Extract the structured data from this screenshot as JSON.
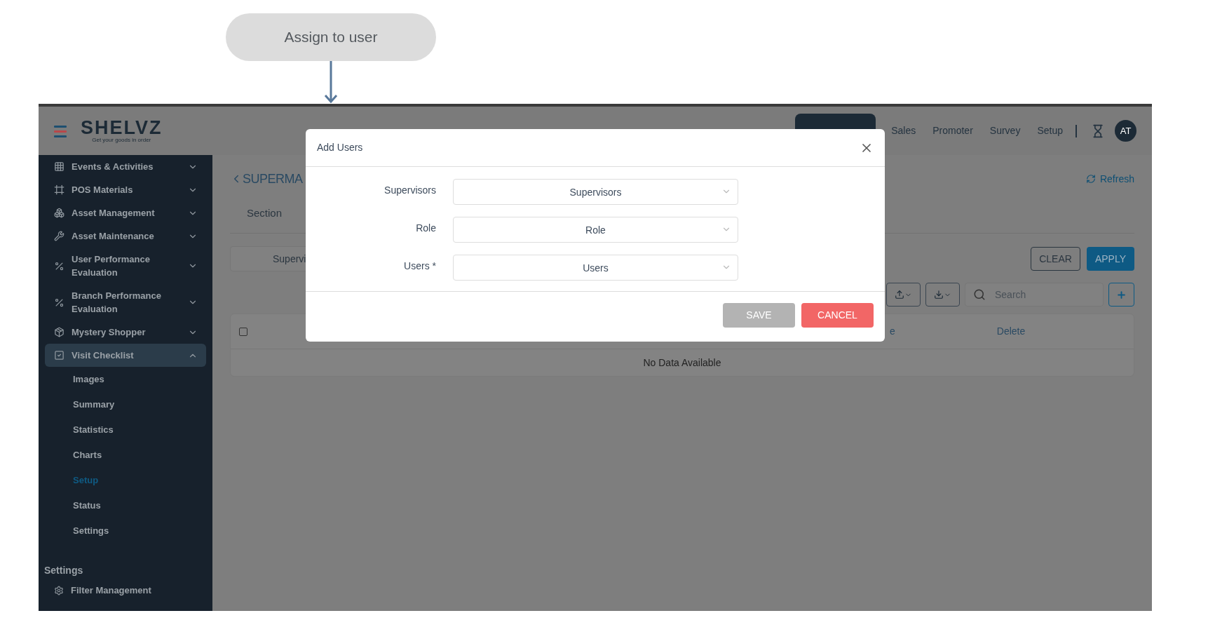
{
  "callout": {
    "label": "Assign to user"
  },
  "header": {
    "logo": "SHELVZ",
    "tagline": "Get your goods in order",
    "nav": [
      {
        "label": "Sales"
      },
      {
        "label": "Promoter"
      },
      {
        "label": "Survey"
      },
      {
        "label": "Setup"
      }
    ],
    "avatar": "AT"
  },
  "sidebar": {
    "items": [
      {
        "label": "Events & Activities",
        "expanded": false,
        "selected": false
      },
      {
        "label": "POS Materials",
        "expanded": false,
        "selected": false
      },
      {
        "label": "Asset Management",
        "expanded": false,
        "selected": false
      },
      {
        "label": "Asset Maintenance",
        "expanded": false,
        "selected": false
      },
      {
        "label": "User Performance Evaluation",
        "expanded": false,
        "selected": false
      },
      {
        "label": "Branch Performance Evaluation",
        "expanded": false,
        "selected": false
      },
      {
        "label": "Mystery Shopper",
        "expanded": false,
        "selected": false
      },
      {
        "label": "Visit Checklist",
        "expanded": true,
        "selected": true,
        "children": [
          {
            "label": "Images",
            "selected": false
          },
          {
            "label": "Summary",
            "selected": false
          },
          {
            "label": "Statistics",
            "selected": false
          },
          {
            "label": "Charts",
            "selected": false
          },
          {
            "label": "Setup",
            "selected": true
          },
          {
            "label": "Status",
            "selected": false
          },
          {
            "label": "Settings",
            "selected": false
          }
        ]
      }
    ],
    "section": {
      "title": "Settings",
      "items": [
        {
          "label": "Filter Management"
        }
      ]
    }
  },
  "page": {
    "title": "SUPERMA",
    "refresh": "Refresh",
    "tabs": [
      {
        "label": "Section",
        "selected": false
      }
    ],
    "filter": {
      "value": "Supervi"
    },
    "clear": "CLEAR",
    "apply": "APPLY",
    "search": {
      "placeholder": "Search"
    },
    "table": {
      "checked": false,
      "columns": [
        "e",
        "Delete"
      ],
      "empty": "No Data Available"
    }
  },
  "modal": {
    "title": "Add Users",
    "fields": [
      {
        "label": "Supervisors",
        "placeholder": "Supervisors"
      },
      {
        "label": "Role",
        "placeholder": "Role"
      },
      {
        "label": "Users *",
        "placeholder": "Users"
      }
    ],
    "save": {
      "label": "SAVE",
      "disabled": true
    },
    "cancel": {
      "label": "CANCEL"
    }
  }
}
